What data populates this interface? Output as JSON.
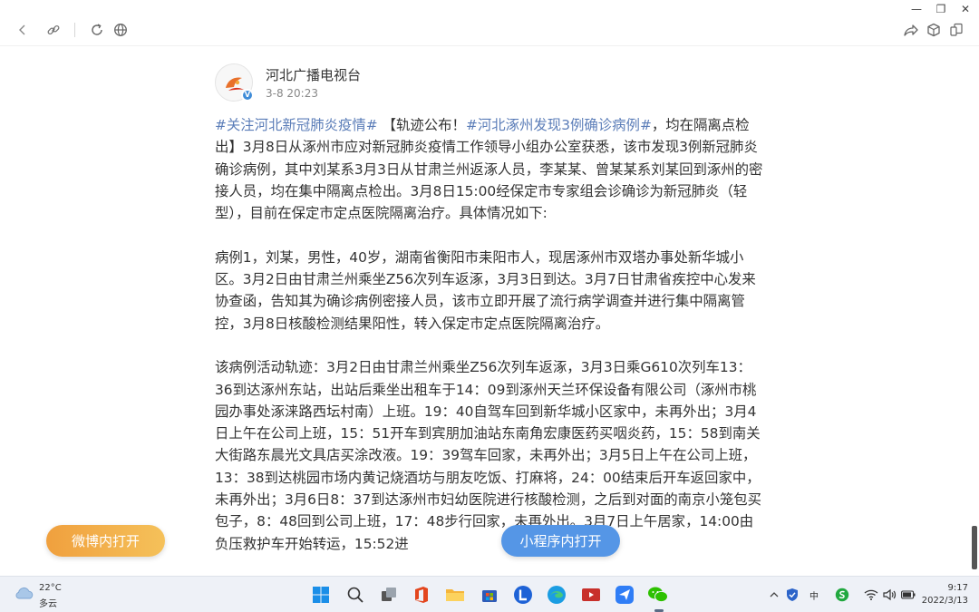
{
  "window_controls": {
    "minimize": "—",
    "maximize": "❐",
    "close": "✕"
  },
  "post": {
    "author": "河北广播电视台",
    "time": "3-8 20:23",
    "paragraphs": [
      [
        {
          "text": "#关注河北新冠肺炎疫情#",
          "tag": true
        },
        {
          "text": " 【轨迹公布！",
          "tag": false
        },
        {
          "text": "#河北涿州发现3例确诊病例#",
          "tag": true
        },
        {
          "text": "，均在隔离点检出】3月8日从涿州市应对新冠肺炎疫情工作领导小组办公室获悉，该市发现3例新冠肺炎确诊病例，其中刘某系3月3日从甘肃兰州返涿人员，李某某、曾某某系刘某回到涿州的密接人员，均在集中隔离点检出。3月8日15:00经保定市专家组会诊确诊为新冠肺炎（轻型），目前在保定市定点医院隔离治疗。具体情况如下:",
          "tag": false
        }
      ],
      [
        {
          "text": "病例1，刘某，男性，40岁，湖南省衡阳市耒阳市人，现居涿州市双塔办事处新华城小区。3月2日由甘肃兰州乘坐Z56次列车返涿，3月3日到达。3月7日甘肃省疾控中心发来协查函，告知其为确诊病例密接人员，该市立即开展了流行病学调查并进行集中隔离管控，3月8日核酸检测结果阳性，转入保定市定点医院隔离治疗。",
          "tag": false
        }
      ],
      [
        {
          "text": "该病例活动轨迹：3月2日由甘肃兰州乘坐Z56次列车返涿，3月3日乘G610次列车13：36到达涿州东站，出站后乘坐出租车于14：09到涿州天兰环保设备有限公司（涿州市桃园办事处涿涞路西坛村南）上班。19：40自驾车回到新华城小区家中，未再外出；3月4日上午在公司上班，15：51开车到宾朋加油站东南角宏康医药买咽炎药，15：58到南关大街路东晨光文具店买涂改液。19：39驾车回家，未再外出；3月5日上午在公司上班，13：38到达桃园市场内黄记烧酒坊与朋友吃饭、打麻将，24：00结束后开车返回家中，未再外出；3月6日8：37到达涿州市妇幼医院进行核酸检测，之后到对面的南京小笼包买包子，8：48回到公司上班，17：48步行回家，未再外出。3月7日上午居家，14:00由负压救护车开始转运，15:52进",
          "tag": false
        }
      ]
    ]
  },
  "buttons": {
    "open_weibo": "微博内打开",
    "open_miniprogram": "小程序内打开"
  },
  "taskbar": {
    "weather_temp": "22°C",
    "weather_desc": "多云",
    "tray_ime": "中",
    "clock_time": "9:17",
    "clock_date": "2022/3/13"
  }
}
